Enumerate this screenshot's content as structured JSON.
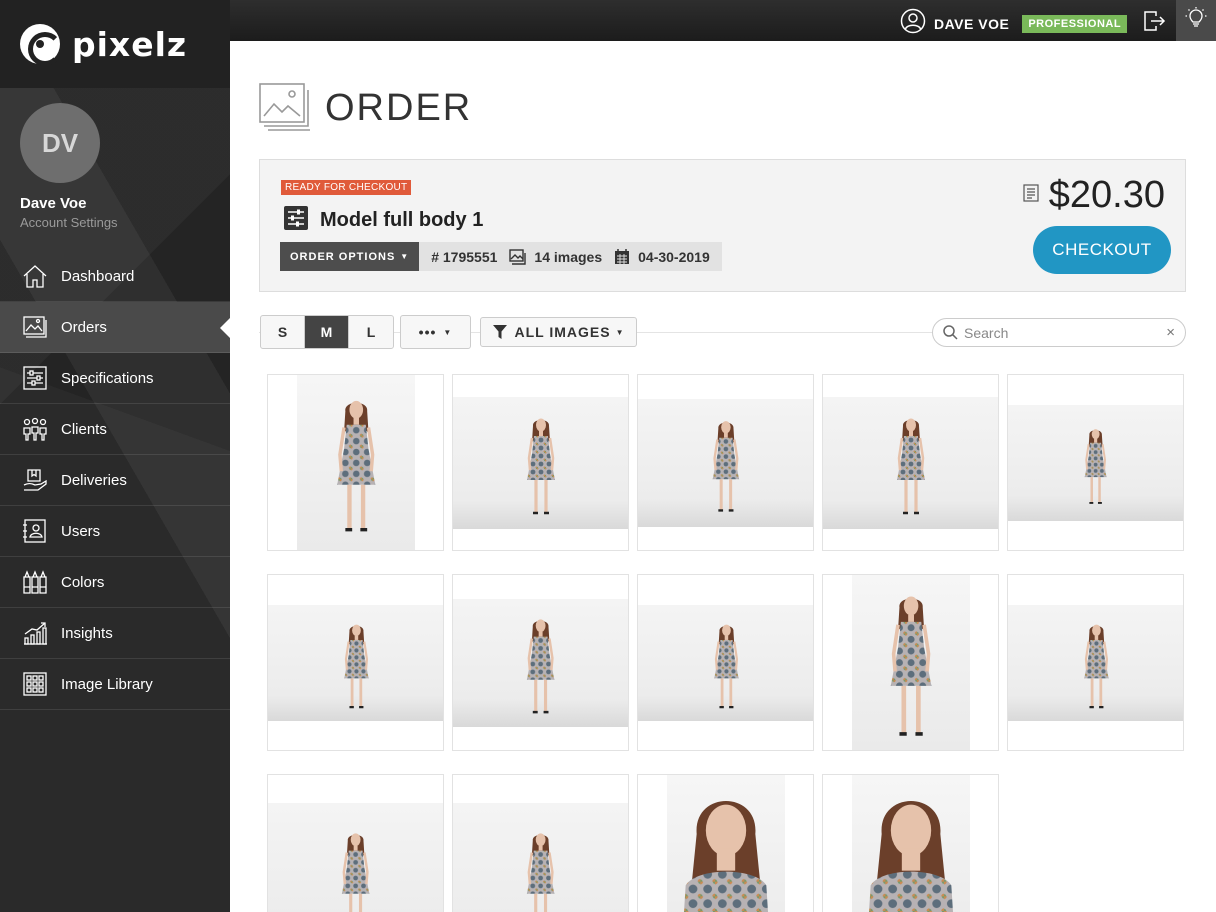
{
  "brand": {
    "name": "pixelz"
  },
  "profile": {
    "initials": "DV",
    "name": "Dave Voe",
    "settings_label": "Account Settings"
  },
  "nav": [
    {
      "label": "Dashboard",
      "icon": "house-icon"
    },
    {
      "label": "Orders",
      "icon": "images-icon",
      "active": true
    },
    {
      "label": "Specifications",
      "icon": "sliders-icon"
    },
    {
      "label": "Clients",
      "icon": "people-icon"
    },
    {
      "label": "Deliveries",
      "icon": "delivery-icon"
    },
    {
      "label": "Users",
      "icon": "contact-card-icon"
    },
    {
      "label": "Colors",
      "icon": "color-tubes-icon"
    },
    {
      "label": "Insights",
      "icon": "chart-icon"
    },
    {
      "label": "Image Library",
      "icon": "grid-icon"
    }
  ],
  "topbar": {
    "username": "DAVE VOE",
    "plan": "PROFESSIONAL"
  },
  "page": {
    "title": "ORDER"
  },
  "order": {
    "status": "READY FOR CHECKOUT",
    "name": "Model full body 1",
    "options_label": "ORDER OPTIONS",
    "number": "# 1795551",
    "image_count": "14 images",
    "date": "04-30-2019",
    "price": "$20.30",
    "checkout_label": "CHECKOUT"
  },
  "toolbar": {
    "sizes": [
      "S",
      "M",
      "L"
    ],
    "active_size": "M",
    "more_label": "•••",
    "filter_label": "ALL IMAGES",
    "search_placeholder": "Search"
  },
  "colors": {
    "accent": "#2196c4",
    "status_ready": "#e05a3a",
    "plan_badge": "#7ab95a",
    "sidebar": "#2a2a2a"
  }
}
